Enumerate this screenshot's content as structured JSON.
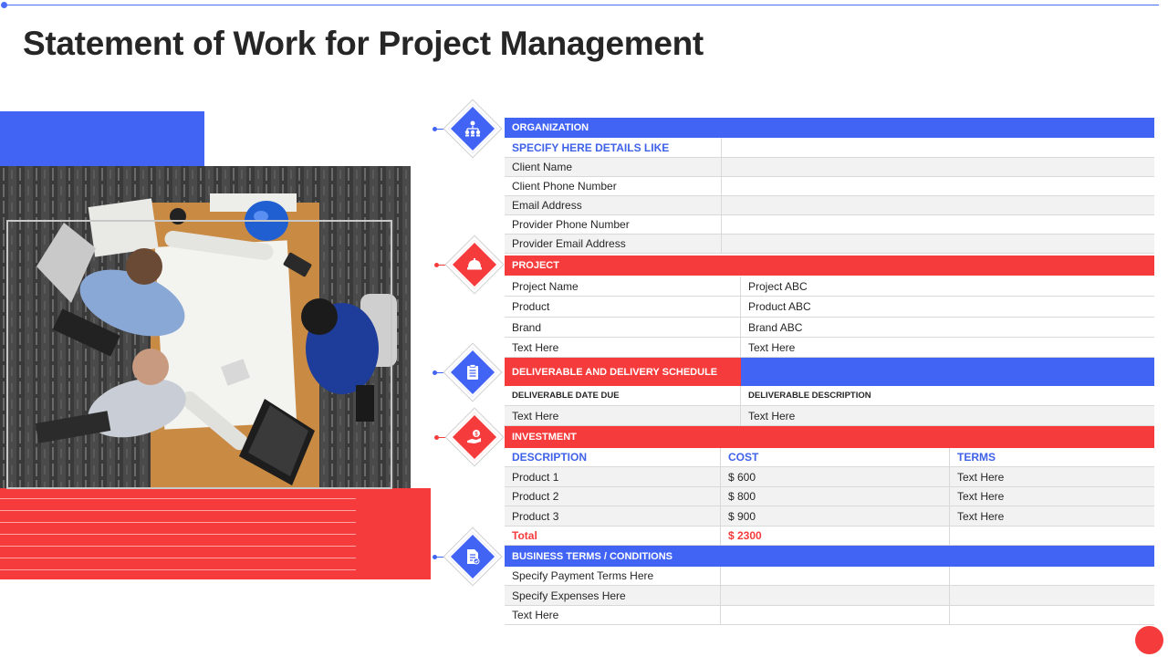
{
  "title": "Statement of Work for Project Management",
  "colors": {
    "blue": "#4264f5",
    "red": "#f53b3b"
  },
  "organization": {
    "header": "ORGANIZATION",
    "sub_header": "SPECIFY  HERE  DETAILS  LIKE",
    "rows": [
      "Client Name",
      "Client Phone Number",
      "Email Address",
      "Provider Phone Number",
      "Provider Email Address"
    ]
  },
  "project": {
    "header": "PROJECT",
    "rows": [
      [
        "Project Name",
        "Project ABC"
      ],
      [
        "Product",
        "Product ABC"
      ],
      [
        "Brand",
        "Brand ABC"
      ],
      [
        "Text Here",
        "Text Here"
      ]
    ]
  },
  "deliverable": {
    "header": "DELIVERABLE AND DELIVERY SCHEDULE",
    "col1": "DELIVERABLE DATE  DUE",
    "col2": "DELIVERABLE DESCRIPTION",
    "rows": [
      [
        "Text Here",
        "Text Here"
      ]
    ]
  },
  "investment": {
    "header": "INVESTMENT",
    "columns": [
      "DESCRIPTION",
      "COST",
      "TERMS"
    ],
    "rows": [
      [
        "Product 1",
        "$ 600",
        "Text Here"
      ],
      [
        "Product 2",
        "$ 800",
        "Text Here"
      ],
      [
        "Product 3",
        "$ 900",
        "Text Here"
      ]
    ],
    "total_label": "Total",
    "total_value": "$ 2300"
  },
  "business": {
    "header": "BUSINESS TERMS  / CONDITIONS",
    "rows": [
      "Specify Payment Terms Here",
      "Specify Expenses Here",
      "Text Here"
    ]
  },
  "icons": {
    "organization": "team-hierarchy-icon",
    "project": "hard-hat-icon",
    "deliverable": "clipboard-icon",
    "investment": "money-hand-icon",
    "business": "document-check-icon"
  }
}
